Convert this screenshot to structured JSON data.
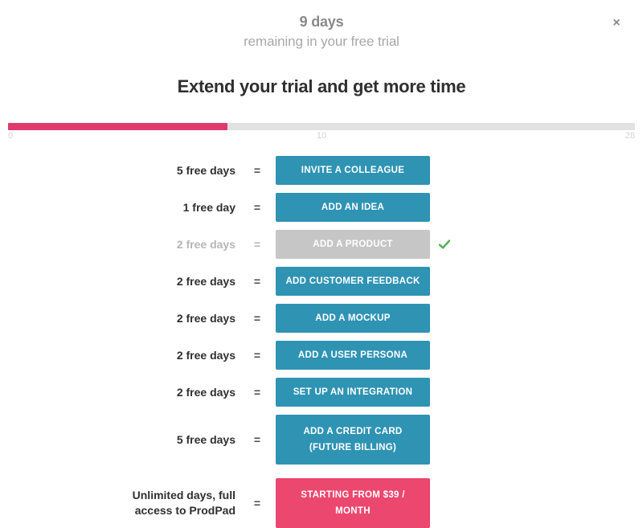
{
  "header": {
    "days_count": "9 days",
    "subtitle": "remaining in your free trial",
    "close_label": "×",
    "close_icon": "close-icon"
  },
  "title": "Extend your trial and get more time",
  "progress": {
    "value": 9,
    "min": 0,
    "max": 28,
    "fill_percent": 35,
    "fill_color": "#e03a6d",
    "track_color": "#e2e2e2",
    "ticks": [
      {
        "label": "0"
      },
      {
        "label": "10"
      },
      {
        "label": "28"
      }
    ]
  },
  "equals_symbol": "=",
  "colors": {
    "action": "#2f93b4",
    "action_disabled": "#c6c6c6",
    "primary": "#ec476f",
    "check": "#4caf50",
    "title": "#2f2f2f",
    "muted": "#b6b6b6"
  },
  "offers": [
    {
      "label": "5 free days",
      "action": "INVITE A COLLEAGUE",
      "state": "available",
      "completed": false
    },
    {
      "label": "1 free day",
      "action": "ADD AN IDEA",
      "state": "available",
      "completed": false
    },
    {
      "label": "2 free days",
      "action": "ADD A PRODUCT",
      "state": "completed",
      "completed": true
    },
    {
      "label": "2 free days",
      "action": "ADD CUSTOMER FEEDBACK",
      "state": "available",
      "completed": false
    },
    {
      "label": "2 free days",
      "action": "ADD A MOCKUP",
      "state": "available",
      "completed": false
    },
    {
      "label": "2 free days",
      "action": "ADD A USER PERSONA",
      "state": "available",
      "completed": false
    },
    {
      "label": "2 free days",
      "action": "SET UP AN INTEGRATION",
      "state": "available",
      "completed": false
    },
    {
      "label": "5 free days",
      "action": "ADD A CREDIT CARD (FUTURE BILLING)",
      "state": "available",
      "completed": false
    },
    {
      "label": "Unlimited days, full access to ProdPad",
      "action": "STARTING FROM $39 / MONTH",
      "state": "primary",
      "completed": false
    }
  ]
}
